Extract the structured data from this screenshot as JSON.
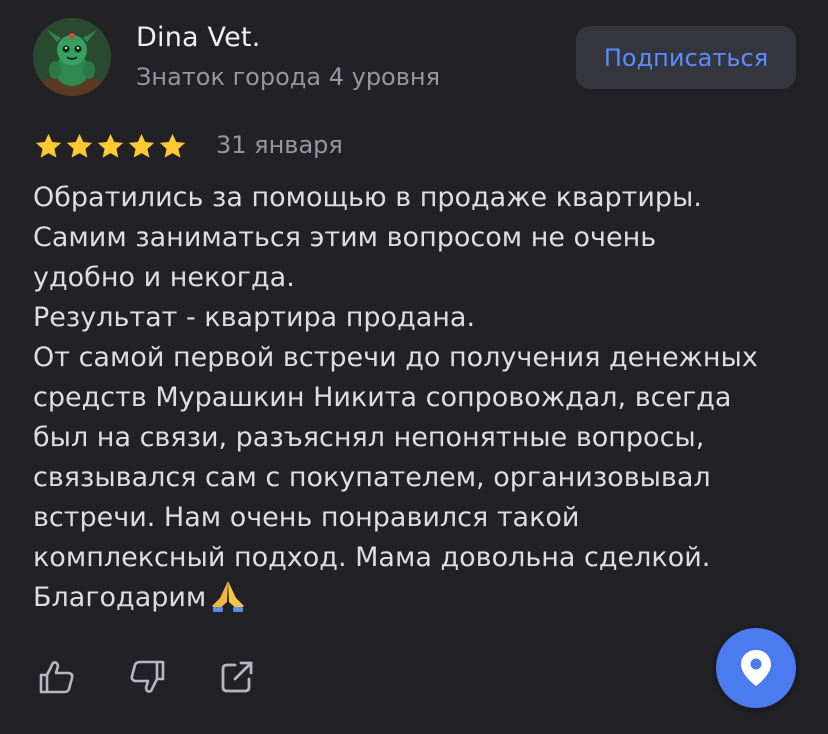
{
  "author": {
    "name": "Dina Vet.",
    "level": "Знаток города 4 уровня",
    "avatar_icon": "creature-figurine-avatar"
  },
  "subscribe": {
    "label": "Подписаться"
  },
  "review": {
    "rating": 5,
    "rating_max": 5,
    "date": "31 января",
    "lines": [
      "Обратились за помощью в продаже квартиры.",
      "Самим заниматься этим вопросом не очень",
      "удобно и некогда.",
      "Результат - квартира продана.",
      "От самой первой встречи до получения денежных",
      "средств Мурашкин Никита сопровождал, всегда",
      "был на связи, разъяснял непонятные вопросы,",
      "связывался сам с покупателем, организовывал",
      "встречи. Нам очень понравился такой",
      "комплексный подход. Мама довольна сделкой.",
      "Благодарим"
    ],
    "trailing_emoji": "folded-hands"
  },
  "actions": {
    "like_icon": "thumbs-up-icon",
    "dislike_icon": "thumbs-down-icon",
    "share_icon": "share-icon"
  },
  "fab": {
    "icon": "map-pin-icon"
  },
  "colors": {
    "background": "#212126",
    "star": "#ffc933",
    "accent": "#5b8cff",
    "fab": "#4c7bf0",
    "muted_text": "#96969e"
  }
}
